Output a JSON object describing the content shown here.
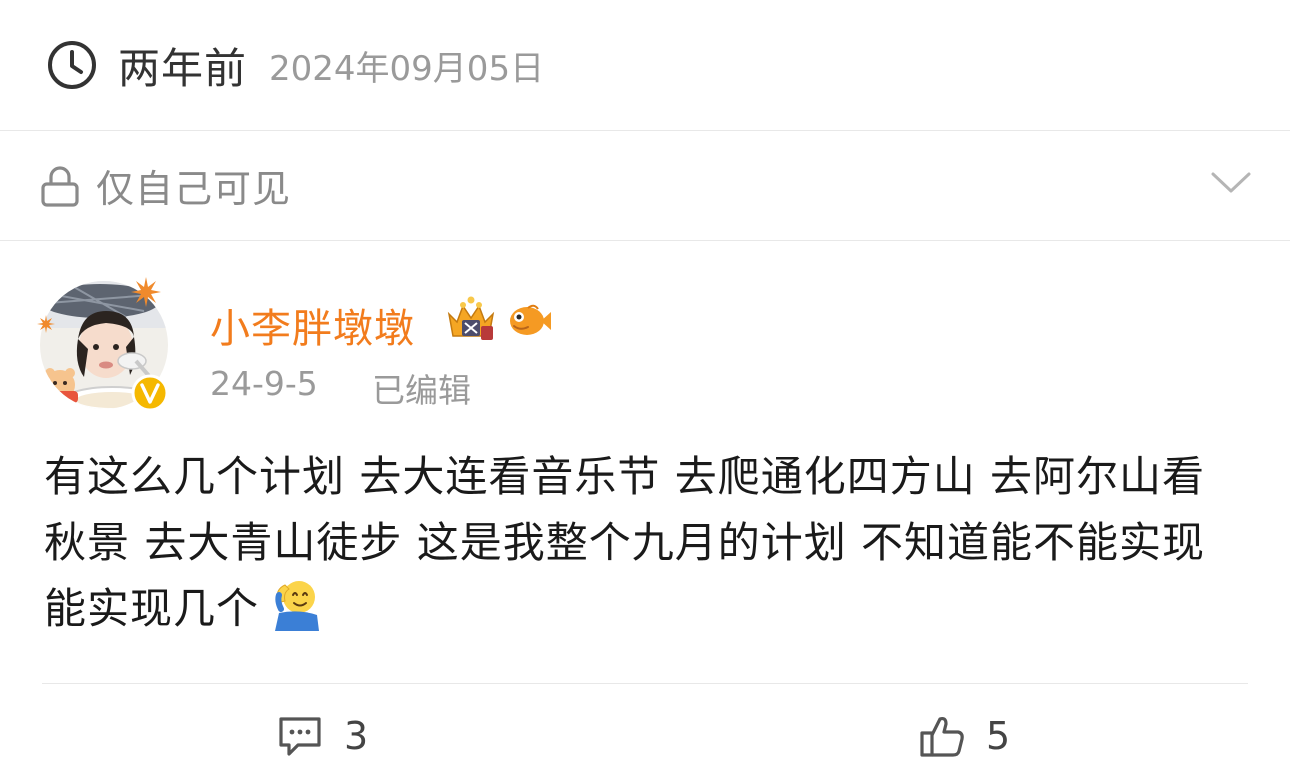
{
  "header": {
    "relative_time": "两年前",
    "full_date": "2024年09月05日"
  },
  "visibility": {
    "label": "仅自己可见"
  },
  "post": {
    "author_name": "小李胖墩墩",
    "date": "24-9-5",
    "edited_label": "已编辑",
    "text": "有这么几个计划 去大连看音乐节 去爬通化四方山 去阿尔山看秋景 去大青山徒步 这是我整个九月的计划 不知道能不能实现 能实现几个"
  },
  "actions": {
    "comment_count": "3",
    "like_count": "5"
  },
  "colors": {
    "author_name": "#f27c1d",
    "secondary_text": "#9a9a9a",
    "verified_badge": "#f5b800",
    "divider": "#e8e8e8"
  },
  "icons": {
    "time": "clock-icon",
    "visibility": "lock-icon",
    "expand": "chevron-down-icon",
    "comment": "comment-icon",
    "like": "thumbs-up-icon"
  }
}
